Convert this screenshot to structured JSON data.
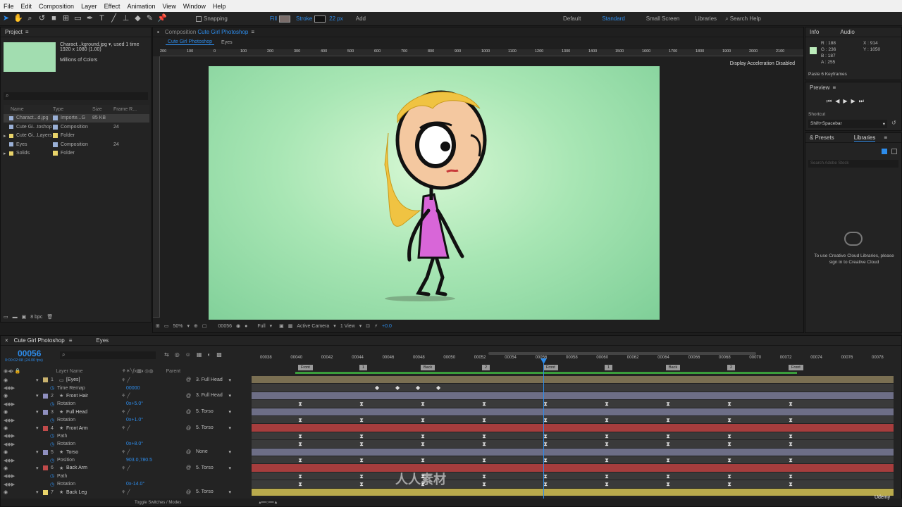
{
  "menu": [
    "File",
    "Edit",
    "Composition",
    "Layer",
    "Effect",
    "Animation",
    "View",
    "Window",
    "Help"
  ],
  "toolbar": {
    "snapping": "Snapping",
    "fill": "Fill",
    "stroke": "Stroke",
    "stroke_width": "22 px",
    "add": "Add",
    "workspaces": [
      "Default",
      "Standard",
      "Small Screen",
      "Libraries"
    ],
    "search_help": "Search Help"
  },
  "project": {
    "title": "Project",
    "item_name": "Charact...kground.jpg",
    "used": ", used 1 time",
    "dims": "1920 x 1080 (1.00)",
    "colors": "Millions of Colors",
    "columns": [
      "Name",
      "Type",
      "Size",
      "Frame R..."
    ],
    "items": [
      {
        "name": "Charact...d.jpg",
        "type": "Importe...G",
        "size": "85 KB",
        "fr": "",
        "color": "#9ab0d6"
      },
      {
        "name": "Cute Gi...toshop",
        "type": "Composition",
        "size": "",
        "fr": "24",
        "color": "#9ab0d6"
      },
      {
        "name": "Cute Gi...Layers",
        "type": "Folder",
        "size": "",
        "fr": "",
        "color": "#e8d36a"
      },
      {
        "name": "Eyes",
        "type": "Composition",
        "size": "",
        "fr": "24",
        "color": "#9ab0d6"
      },
      {
        "name": "Solids",
        "type": "Folder",
        "size": "",
        "fr": "",
        "color": "#e8d36a"
      }
    ],
    "bpc": "8 bpc"
  },
  "composition": {
    "panel_title": "Composition",
    "comp_name": "Cute Girl Photoshop",
    "tabs": [
      "Cute Girl Photoshop",
      "Eyes"
    ],
    "ruler_labels": [
      "200",
      "100",
      "0",
      "100",
      "200",
      "300",
      "400",
      "500",
      "600",
      "700",
      "800",
      "900",
      "1000",
      "1100",
      "1200",
      "1300",
      "1400",
      "1500",
      "1600",
      "1700",
      "1800",
      "1900",
      "2000",
      "2100"
    ],
    "display_accel": "Display Acceleration Disabled",
    "zoom": "50%",
    "timecode": "00056",
    "resolution": "Full",
    "camera": "Active Camera",
    "view": "1 View",
    "exposure": "+0.0",
    "canvas_color": "#8fd9a6"
  },
  "info": {
    "tabs": [
      "Info",
      "Audio"
    ],
    "r": "R : 188",
    "g": "G : 236",
    "b": "B : 187",
    "a": "A : 255",
    "x": "X : 914",
    "y": "Y : 1050",
    "swatch": "#bcecbb",
    "message": "Paste 6 Keyframes"
  },
  "preview": {
    "title": "Preview",
    "shortcut_label": "Shortcut",
    "shortcut_value": "Shift+Spacebar"
  },
  "libraries": {
    "tabs": [
      "& Presets",
      "Libraries"
    ],
    "search_placeholder": "Search Adobe Stock",
    "message": "To use Creative Cloud Libraries, please sign in to Creative Cloud"
  },
  "timeline": {
    "tabs": [
      "Cute Girl Photoshop",
      "Eyes"
    ],
    "timecode": "00056",
    "timecode_sub": "0:00:02:08 (24.00 fps)",
    "col_layer": "Layer Name",
    "col_parent": "Parent",
    "frame_labels": [
      "00038",
      "00040",
      "00042",
      "00044",
      "00046",
      "00048",
      "00050",
      "00052",
      "00054",
      "00056",
      "00058",
      "00060",
      "00062",
      "00064",
      "00066",
      "00068",
      "00070",
      "00072",
      "00074",
      "00076",
      "00078"
    ],
    "markers": [
      "Front",
      "1",
      "Back",
      "2",
      "Front",
      "1",
      "Back",
      "2",
      "Front"
    ],
    "toggle": "Toggle Switches / Modes",
    "layers": [
      {
        "num": "1",
        "name": "[Eyes]",
        "kind": "layer",
        "parent": "3. Full Head",
        "color": "#c9b26e",
        "bar": "#7a6f52"
      },
      {
        "num": "",
        "name": "Time Remap",
        "kind": "prop",
        "value": "00000",
        "bar": "#3a3a3a"
      },
      {
        "num": "2",
        "name": "Front Hair",
        "kind": "layer",
        "parent": "3. Full Head",
        "color": "#8f8fbf",
        "bar": "#6d6e86"
      },
      {
        "num": "",
        "name": "Rotation",
        "kind": "prop",
        "value": "0x+5.0°",
        "bar": "#3a3a3a"
      },
      {
        "num": "3",
        "name": "Full Head",
        "kind": "layer",
        "parent": "5. Torso",
        "color": "#8f8fbf",
        "bar": "#6d6e86"
      },
      {
        "num": "",
        "name": "Rotation",
        "kind": "prop",
        "value": "0x+1.0°",
        "bar": "#3a3a3a"
      },
      {
        "num": "4",
        "name": "Front Arm",
        "kind": "layer",
        "parent": "5. Torso",
        "color": "#c04a4a",
        "bar": "#a63d3d"
      },
      {
        "num": "",
        "name": "Path",
        "kind": "prop",
        "value": "",
        "bar": "#3a3a3a"
      },
      {
        "num": "",
        "name": "Rotation",
        "kind": "prop",
        "value": "0x+8.0°",
        "bar": "#3a3a3a"
      },
      {
        "num": "5",
        "name": "Torso",
        "kind": "layer",
        "parent": "None",
        "color": "#8f8fbf",
        "bar": "#6d6e86"
      },
      {
        "num": "",
        "name": "Position",
        "kind": "prop",
        "value": "903.0,780.5",
        "bar": "#3a3a3a"
      },
      {
        "num": "6",
        "name": "Back Arm",
        "kind": "layer",
        "parent": "5. Torso",
        "color": "#c04a4a",
        "bar": "#a63d3d"
      },
      {
        "num": "",
        "name": "Path",
        "kind": "prop",
        "value": "",
        "bar": "#3a3a3a"
      },
      {
        "num": "",
        "name": "Rotation",
        "kind": "prop",
        "value": "0x-14.0°",
        "bar": "#3a3a3a"
      },
      {
        "num": "7",
        "name": "Back Leg",
        "kind": "layer",
        "parent": "5. Torso",
        "color": "#e8d36a",
        "bar": "#b9aa4c"
      }
    ]
  },
  "watermark": {
    "brand": "人人素材",
    "udemy": "Udemy"
  }
}
